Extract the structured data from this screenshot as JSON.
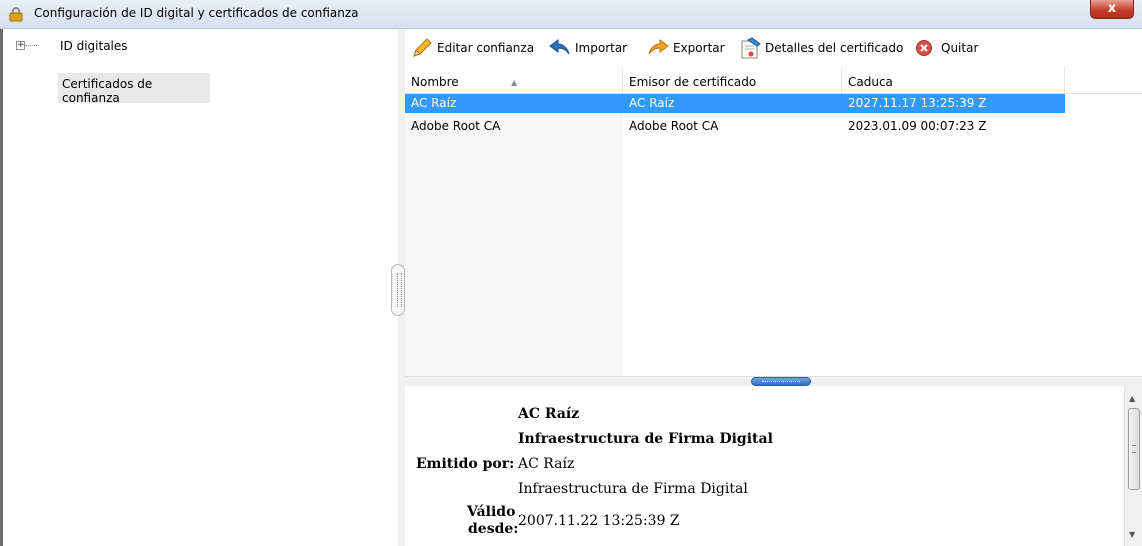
{
  "window": {
    "title": "Configuración de ID digital y certificados de confianza",
    "close_label": "x"
  },
  "tree": {
    "items": [
      {
        "label": "ID digitales",
        "expander": "+"
      },
      {
        "label": "Certificados de confianza"
      }
    ]
  },
  "toolbar": {
    "edit_label": "Editar confianza",
    "import_label": "Importar",
    "export_label": "Exportar",
    "details_label": "Detalles del certificado",
    "remove_label": "Quitar"
  },
  "table": {
    "columns": [
      "Nombre",
      "Emisor de certificado",
      "Caduca"
    ],
    "rows": [
      {
        "name": "AC Raíz",
        "issuer": "AC Raíz",
        "expires": "2027.11.17 13:25:39 Z",
        "selected": true
      },
      {
        "name": "Adobe Root CA",
        "issuer": "Adobe Root CA",
        "expires": "2023.01.09 00:07:23 Z",
        "selected": false
      }
    ]
  },
  "details": {
    "subject_name": "AC Raíz",
    "subject_org": "Infraestructura de Firma Digital",
    "issued_by_label": "Emitido por:",
    "issuer_name": "AC Raíz",
    "issuer_org": "Infraestructura de Firma Digital",
    "valid_from_label_1": "Válido",
    "valid_from_label_2": "desde:",
    "valid_from": "2007.11.22 13:25:39 Z"
  },
  "colors": {
    "selection": "#3399ff",
    "close_button": "#c7412f",
    "accent": "#2f6fc4"
  },
  "icons": [
    "lock-icon",
    "pencil-icon",
    "import-arrow-icon",
    "export-arrow-icon",
    "certificate-icon",
    "remove-icon"
  ]
}
